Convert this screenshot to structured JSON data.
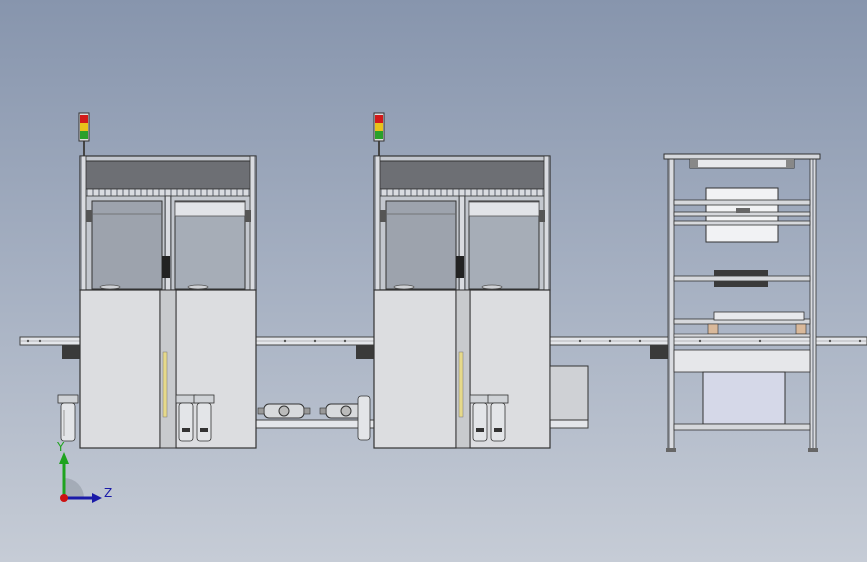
{
  "viewport": {
    "background_top": "#8795ad",
    "background_bottom": "#c6ccd6"
  },
  "triad": {
    "y_label": "Y",
    "z_label": "Z",
    "y_color": "#1fa31f",
    "z_color": "#1a1aa8",
    "origin_color": "#cc1111"
  },
  "components": {
    "machines": [
      "machine-unit-1",
      "machine-unit-2"
    ],
    "rack": "storage-rack",
    "conveyor": "conveyor-line",
    "signal_tower_colors": [
      "#d21a1a",
      "#e8c21a",
      "#2aa02a"
    ]
  }
}
